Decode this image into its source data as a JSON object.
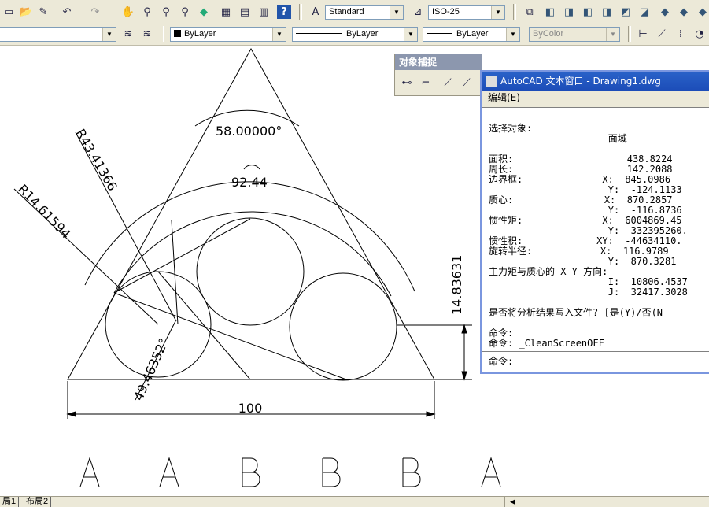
{
  "toolbar_top": {
    "text_style": "Standard",
    "dim_style": "ISO-25",
    "icons": [
      "new-icon",
      "open-icon",
      "pencil-icon",
      "undo-icon",
      "redo-icon",
      "pan-icon",
      "zoom-realtime-icon",
      "zoom-window-icon",
      "zoom-previous-icon",
      "properties-icon",
      "design-center-icon",
      "tool-palette-icon",
      "sheet-set-icon",
      "help-icon",
      "text-style-icon",
      "dim-style-icon",
      "view-top-icon",
      "view-bottom-icon",
      "view-left-icon",
      "view-right-icon",
      "view-front-icon",
      "view-back-icon",
      "iso-sw-icon",
      "iso-se-icon",
      "iso-ne-icon"
    ]
  },
  "toolbar_second": {
    "layer_value": "",
    "color": "ByLayer",
    "linetype": "ByLayer",
    "lineweight": "ByLayer",
    "plotstyle": "ByColor"
  },
  "osnap_toolbar": {
    "title": "对象捕捉"
  },
  "text_window": {
    "title": "AutoCAD 文本窗口 - Drawing1.dwg",
    "menu_edit": "编辑(E)",
    "lines": [
      "选择对象:",
      " ----------------    面域   --------",
      "",
      "面积:                    438.8224",
      "周长:                    142.2088",
      "边界框:              X:  845.0986",
      "                     Y:  -124.1133",
      "质心:                X:  870.2857",
      "                     Y:  -116.8736",
      "惯性矩:              X:  6004869.45",
      "                     Y:  332395260.",
      "惯性积:             XY:  -44634110.",
      "旋转半径:            X:  116.9789",
      "                     Y:  870.3281",
      "主力矩与质心的 X-Y 方向:",
      "                     I:  10806.4537",
      "                     J:  32417.3028",
      "",
      "是否将分析结果写入文件? [是(Y)/否(N",
      "",
      "命令:",
      "命令: _CleanScreenOFF"
    ],
    "command_prompt": "命令:"
  },
  "drawing": {
    "dim_angle_top": "58.00000°",
    "dim_arc_length": "92.44",
    "dim_radius_large": "R43.41366",
    "dim_radius_small": "R14.61594",
    "dim_angle_bottom": "49.46352°",
    "dim_base": "100",
    "dim_height": "14.83631",
    "letters": [
      "A",
      "A",
      "B",
      "B",
      "B",
      "A"
    ]
  },
  "status_tabs": [
    "局1",
    "布局2"
  ]
}
